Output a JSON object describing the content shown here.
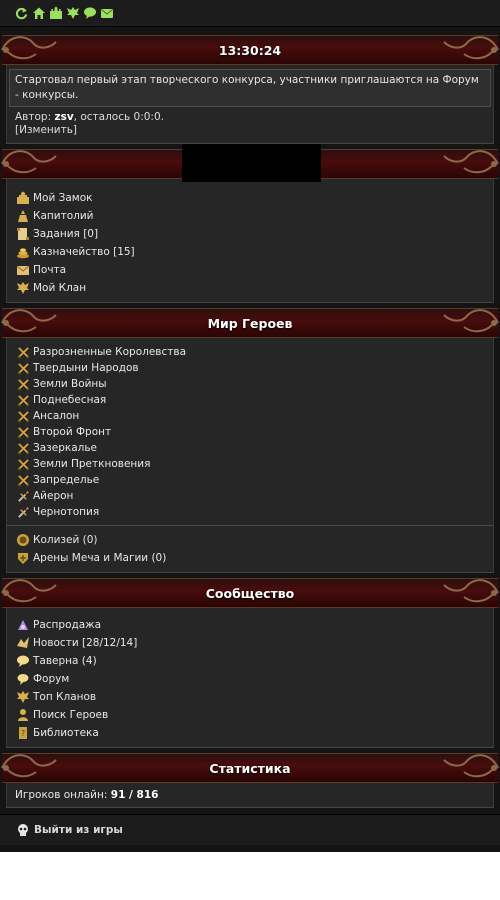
{
  "topbar": {
    "icons": [
      "refresh-icon",
      "home-icon",
      "castle-icon",
      "clan-icon",
      "chat-icon",
      "mail-icon"
    ]
  },
  "clock": {
    "time": "13:30:24"
  },
  "news": {
    "text": "Стартовал первый этап творческого конкурса, участники приглашаются на Форум - конкурсы.",
    "author_prefix": "Автор: ",
    "author": "zsv",
    "remaining": ", осталось 0:0:0.",
    "change_link": "[Изменить]"
  },
  "personal": {
    "items": [
      {
        "label": "Мой Замок",
        "icon": "castle-icon"
      },
      {
        "label": "Капитолий",
        "icon": "capitol-icon"
      },
      {
        "label": "Задания [0]",
        "icon": "scroll-icon"
      },
      {
        "label": "Казначейство [15]",
        "icon": "gold-icon"
      },
      {
        "label": "Почта",
        "icon": "mail-icon"
      },
      {
        "label": "Мой Клан",
        "icon": "clan-icon"
      }
    ]
  },
  "world": {
    "title": "Мир Героев",
    "realms": [
      {
        "label": "Разрозненные Королевства",
        "icon": "crossed-swords-icon"
      },
      {
        "label": "Твердыни Народов",
        "icon": "crossed-swords-icon"
      },
      {
        "label": "Земли Войны",
        "icon": "crossed-swords-icon"
      },
      {
        "label": "Поднебесная",
        "icon": "crossed-swords-icon"
      },
      {
        "label": "Ансалон",
        "icon": "crossed-swords-icon"
      },
      {
        "label": "Второй Фронт",
        "icon": "crossed-swords-icon"
      },
      {
        "label": "Зазеркалье",
        "icon": "crossed-swords-icon"
      },
      {
        "label": "Земли Преткновения",
        "icon": "crossed-swords-icon"
      },
      {
        "label": "Запределье",
        "icon": "crossed-swords-icon"
      },
      {
        "label": "Айерон",
        "icon": "sword-torch-icon"
      },
      {
        "label": "Чернотопия",
        "icon": "sword-torch-icon"
      }
    ],
    "arenas": [
      {
        "label": "Колизей (0)",
        "icon": "colosseum-icon"
      },
      {
        "label": "Арены Меча и Магии (0)",
        "icon": "arena-icon"
      }
    ]
  },
  "community": {
    "title": "Сообщество",
    "items": [
      {
        "label": "Распродажа",
        "icon": "sale-icon"
      },
      {
        "label": "Новости [28/12/14]",
        "icon": "news-icon"
      },
      {
        "label": "Таверна (4)",
        "icon": "tavern-icon"
      },
      {
        "label": "Форум",
        "icon": "forum-icon"
      },
      {
        "label": "Топ Кланов",
        "icon": "top-clans-icon"
      },
      {
        "label": "Поиск Героев",
        "icon": "search-heroes-icon"
      },
      {
        "label": "Библиотека",
        "icon": "library-icon"
      }
    ]
  },
  "stats": {
    "title": "Статистика",
    "online_label": "Игроков онлайн: ",
    "online_value": "91 / 816"
  },
  "logout": {
    "label": "Выйти из игры",
    "icon": "skull-icon"
  },
  "colors": {
    "banner": "#4a0c0c",
    "panel": "#262626",
    "background": "#141414"
  }
}
